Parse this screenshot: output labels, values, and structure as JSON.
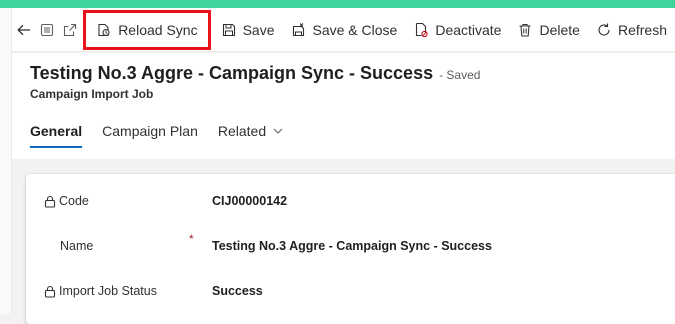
{
  "commands": {
    "back": "back-icon",
    "record_set": "record-icon",
    "open_new_window": "popout-icon",
    "reload_sync": "Reload Sync",
    "save": "Save",
    "save_close": "Save & Close",
    "deactivate": "Deactivate",
    "delete": "Delete",
    "refresh": "Refresh"
  },
  "record": {
    "title": "Testing No.3 Aggre - Campaign Sync - Success",
    "status": "- Saved",
    "entity": "Campaign Import Job"
  },
  "tabs": [
    {
      "label": "General"
    },
    {
      "label": "Campaign Plan"
    },
    {
      "label": "Related"
    }
  ],
  "fields": [
    {
      "label": "Code",
      "value": "CIJ00000142"
    },
    {
      "label": "Name",
      "required_marker": "*",
      "value": "Testing No.3 Aggre - Campaign Sync - Success"
    },
    {
      "label": "Import Job Status",
      "value": "Success"
    }
  ],
  "colors": {
    "accent_top": "#3fd49b",
    "highlight_box": "#e8141b",
    "tab_underline": "#0f6cbd"
  }
}
